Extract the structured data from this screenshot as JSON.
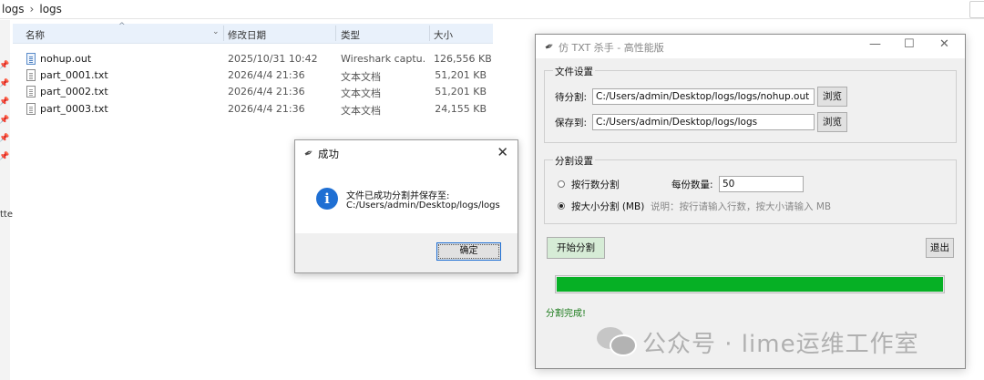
{
  "explorer": {
    "breadcrumb": [
      "logs",
      "logs"
    ],
    "columns": {
      "name": "名称",
      "date": "修改日期",
      "type": "类型",
      "size": "大小"
    },
    "files": [
      {
        "name": "nohup.out",
        "date": "2025/10/31 10:42",
        "type": "Wireshark captu...",
        "size": "126,556 KB",
        "icon": "pcap-file-icon"
      },
      {
        "name": "part_0001.txt",
        "date": "2026/4/4 21:36",
        "type": "文本文档",
        "size": "51,201 KB",
        "icon": "text-file-icon"
      },
      {
        "name": "part_0002.txt",
        "date": "2026/4/4 21:36",
        "type": "文本文档",
        "size": "51,201 KB",
        "icon": "text-file-icon"
      },
      {
        "name": "part_0003.txt",
        "date": "2026/4/4 21:36",
        "type": "文本文档",
        "size": "24,155 KB",
        "icon": "text-file-icon"
      }
    ],
    "edge_text": "tte"
  },
  "dialog": {
    "title": "成功",
    "message_line1": "文件已成功分割并保存至:",
    "message_line2": "C:/Users/admin/Desktop/logs/logs",
    "ok_label": "确定",
    "info_glyph": "i"
  },
  "app": {
    "title": "仿 TXT 杀手 - 高性能版",
    "file_group": {
      "legend": "文件设置",
      "source_label": "待分割:",
      "source_value": "C:/Users/admin/Desktop/logs/logs/nohup.out",
      "dest_label": "保存到:",
      "dest_value": "C:/Users/admin/Desktop/logs/logs",
      "browse_label": "浏览"
    },
    "split_group": {
      "legend": "分割设置",
      "by_lines_label": "按行数分割",
      "per_label": "每份数量:",
      "per_value": "50",
      "by_size_label": "按大小分割 (MB)",
      "hint": "说明：按行请输入行数，按大小请输入 MB",
      "selected": "by_size"
    },
    "start_label": "开始分割",
    "exit_label": "退出",
    "progress": 1.0,
    "progress_color": "#06b025",
    "status": "分割完成!"
  },
  "watermark": {
    "text": "公众号 · lime运维工作室"
  }
}
